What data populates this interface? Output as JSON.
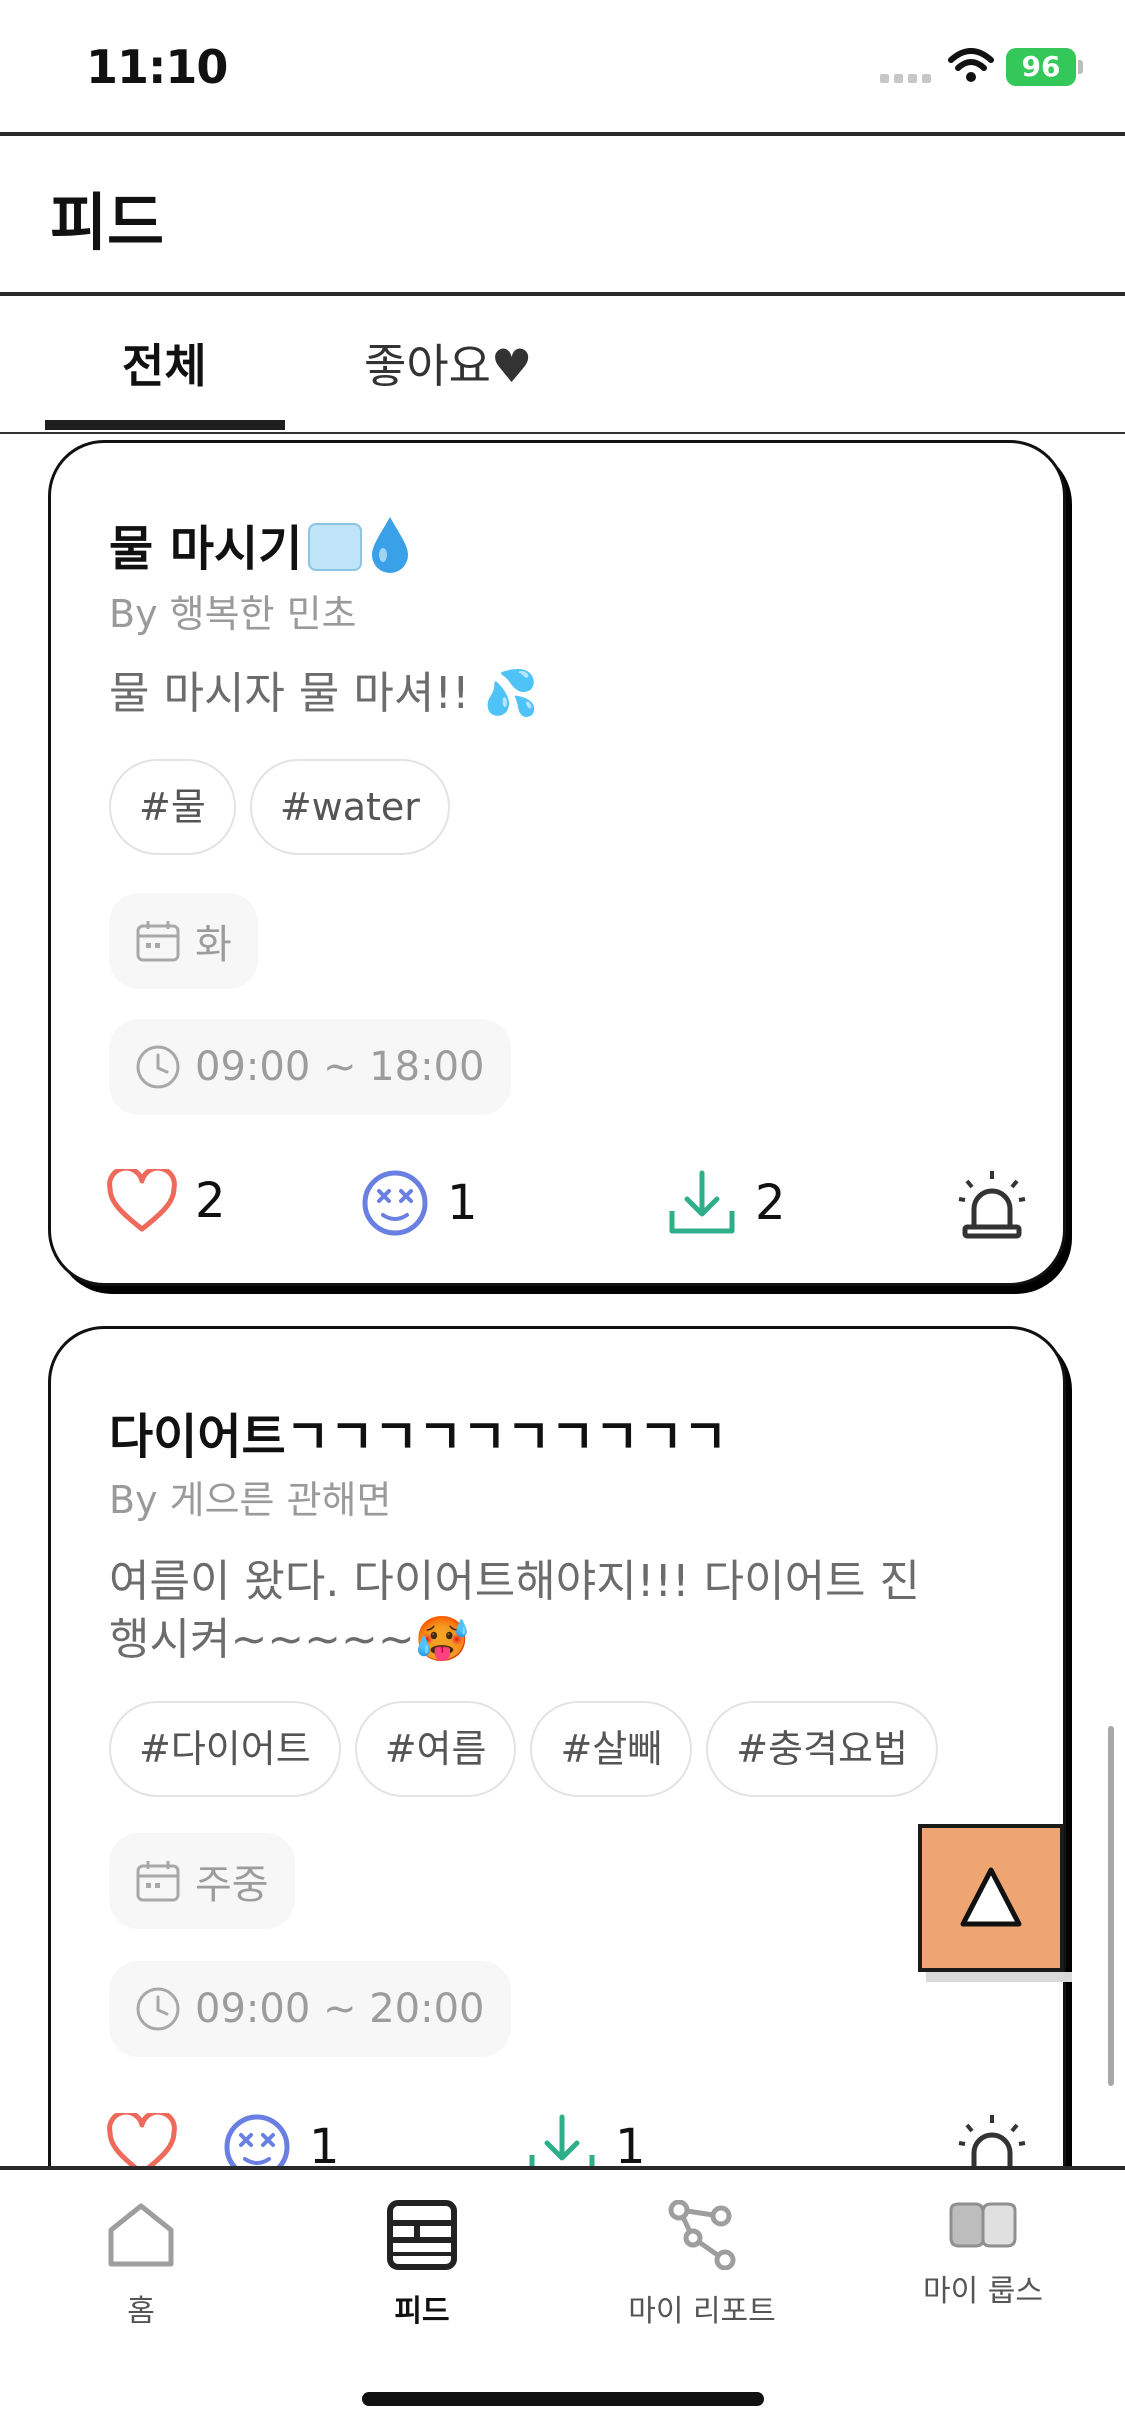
{
  "status_bar": {
    "time": "11:10",
    "battery": "96"
  },
  "header": {
    "title": "피드"
  },
  "tabs": [
    {
      "label": "전체",
      "active": true
    },
    {
      "label": "좋아요♥",
      "active": false
    }
  ],
  "cards": [
    {
      "title": "물 마시기",
      "author": "By  행복한 민초",
      "description": "물 마시자 물 마셔!!  💦",
      "tags": [
        "#물",
        "#water"
      ],
      "days": "화",
      "time_range": "09:00 ~ 18:00",
      "likes": "2",
      "mocks": "1",
      "downloads": "2"
    },
    {
      "title": "다이어트ㄱㄱㄱㄱㄱㄱㄱㄱㄱㄱ",
      "author": "By 게으른 관해면",
      "description": "여름이 왔다. 다이어트해야지!!! 다이어트 진행시켜~~~~~🥵",
      "tags": [
        "#다이어트",
        "#여름",
        "#살빼",
        "#충격요법"
      ],
      "days": "주중",
      "time_range": "09:00 ~ 20:00",
      "likes": "",
      "mocks": "1",
      "downloads": "1"
    }
  ],
  "bottom_nav": [
    {
      "label": "홈",
      "icon": "home-icon",
      "active": false
    },
    {
      "label": "피드",
      "icon": "feed-icon",
      "active": true
    },
    {
      "label": "마이 리포트",
      "icon": "report-icon",
      "active": false
    },
    {
      "label": "마이 룹스",
      "icon": "loops-icon",
      "active": false
    }
  ],
  "colors": {
    "heart": "#ee6b5b",
    "mock": "#6a7fe2",
    "download": "#2fae8a",
    "scroll_top_button": "#eea572",
    "battery": "#34c759"
  }
}
